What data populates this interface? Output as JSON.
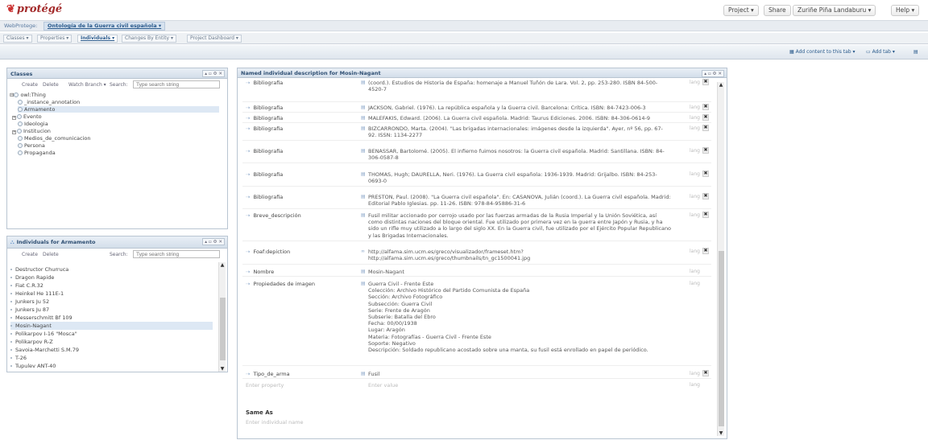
{
  "app": {
    "logo": "protégé",
    "logo_mark": "❦"
  },
  "topbar": {
    "project_label": "Project ▾",
    "share_label": "Share",
    "user_label": "Zuriñe Piña Landaburu ▾",
    "help_label": "Help ▾"
  },
  "breadcrumb": {
    "root": "WebProtege:",
    "project": "Ontología de la Guerra civil española",
    "project_menu": "▾"
  },
  "tabs": [
    {
      "label": "Classes ▾"
    },
    {
      "label": "Properties ▾"
    },
    {
      "label": "Individuals ▾"
    },
    {
      "label": "Changes By Entity ▾"
    },
    {
      "label": "Project Dashboard ▾"
    }
  ],
  "toolstrip": {
    "add_content": "Add content to this tab ▾",
    "add_tab": "Add tab ▾"
  },
  "classes_panel": {
    "title": "Classes",
    "controls": "▴ ▫ ⚙ ✕",
    "create": "Create",
    "delete": "Delete",
    "watch": "Watch Branch ▾",
    "search_label": "Search:",
    "search_placeholder": "Type search string",
    "items": [
      {
        "label": "owl:Thing",
        "expand": "⊟"
      },
      {
        "label": "_instance_annotation",
        "expand": ""
      },
      {
        "label": "Armamento",
        "expand": ""
      },
      {
        "label": "Evento",
        "expand": "+"
      },
      {
        "label": "Ideologia",
        "expand": ""
      },
      {
        "label": "Institucion",
        "expand": "+"
      },
      {
        "label": "Medios_de_comunicacion",
        "expand": ""
      },
      {
        "label": "Persona",
        "expand": ""
      },
      {
        "label": "Propaganda",
        "expand": ""
      }
    ]
  },
  "individuals_panel": {
    "title": "Individuals for Armamento",
    "controls": "▴ ▫ ⚙ ✕",
    "create": "Create",
    "delete": "Delete",
    "search_label": "Search:",
    "search_placeholder": "Type search string",
    "items": [
      "Destructor Churruca",
      "Dragon Rapide",
      "Fiat C.R.32",
      "Heinkel He 111E-1",
      "Junkers Ju 52",
      "Junkers Ju 87",
      "Messerschmitt Bf 109",
      "Mosin-Nagant",
      "Polikarpov I-16 \"Mosca\"",
      "Polikarpov R-Z",
      "Savoia-Marchetti S.M.79",
      "T-26",
      "Tupulev ANT-40"
    ]
  },
  "description_panel": {
    "title": "Named individual description for Mosin-Nagant",
    "controls": "▴ ▫ ⚙ ✕",
    "properties": [
      {
        "name": "Bibliografia",
        "value": "(coord.). Estudios de Historia de España: homenaje a Manuel Tuñón de Lara. Vol. 2, pp. 253-280. ISBN 84-500-\n4520-7",
        "lang": "lang"
      },
      {
        "name": "Bibliografia",
        "value": "JACKSON, Gabriel. (1976). La república española y la Guerra civil. Barcelona: Crítica. ISBN: 84-7423-006-3",
        "lang": "lang"
      },
      {
        "name": "Bibliografia",
        "value": "MALEFAKIS, Edward. (2006). La Guerra civil española. Madrid: Taurus Ediciones. 2006. ISBN: 84-306-0614-9",
        "lang": "lang"
      },
      {
        "name": "Bibliografia",
        "value": "BIZCARRONDO, Marta. (2004). \"Las brigadas internacionales: imágenes desde la izquierda\". Ayer, nº 56, pp. 67-\n92. ISSN: 1134-2277",
        "lang": "lang"
      },
      {
        "name": "Bibliografia",
        "value": "BENASSAR, Bartolomé. (2005). El infierno fuimos nosotros: la Guerra civil española. Madrid: Santillana. ISBN: 84-\n306-0587-8",
        "lang": "lang"
      },
      {
        "name": "Bibliografia",
        "value": "THOMAS, Hugh; DAURELLA, Neri. (1976). La Guerra civil española: 1936-1939. Madrid: Grijalbo. ISBN: 84-253-\n0693-0",
        "lang": "lang"
      },
      {
        "name": "Bibliografia",
        "value": "PRESTON, Paul. (2008). \"La Guerra civil española\". En: CASANOVA, Julián (coord.). La Guerra civil española. Madrid:\nEditorial Pablo Iglesias. pp. 11-26. ISBN: 978-84-95886-31-6",
        "lang": "lang"
      },
      {
        "name": "Breve_descripción",
        "value": "Fusil militar accionado por cerrojo usado por las fuerzas armadas de la Rusia Imperial y la Unión Soviética, así\ncomo distintas naciones del bloque oriental. Fue utilizado por primera vez en la guerra entre Japón y Rusia, y ha\nsido un rifle muy utilizado a lo largo del siglo XX. En la Guerra civil, fue utilizado por el Ejército Popular Republicano\ny las Brigadas Internacionales.",
        "lang": "lang"
      },
      {
        "name": "Foaf:depiction",
        "value": "http://alfama.sim.ucm.es/greco/visualizador/frameset.htm?\nhttp://alfama.sim.ucm.es/greco/thumbnails/tn_gc1500041.jpg",
        "lang": "lang"
      },
      {
        "name": "Nombre",
        "value": "Mosin-Nagant",
        "lang": "lang"
      },
      {
        "name": "Propiedades de imagen",
        "value": "Guerra Civil - Frente Este\nColección: Archivo Histórico del Partido Comunista de España\nSección: Archivo Fotográfico\nSubsección: Guerra Civil\nSerie: Frente de Aragón\nSubserie: Batalla del Ebro\nFecha: 00/00/1938\nLugar: Aragón\nMateria: Fotografías - Guerra Civil - Frente Este\nSoporte: Negativo\nDescripción: Soldado republicano acostado sobre una manta, su fusil está enrollado en papel de periódico.",
        "lang": "lang"
      },
      {
        "name": "Tipo_de_arma",
        "value": "Fusil",
        "lang": "lang"
      }
    ],
    "enter_property": "Enter property",
    "enter_value": "Enter value",
    "enter_lang": "lang",
    "same_as_title": "Same As",
    "same_as_placeholder": "Enter individual name"
  }
}
